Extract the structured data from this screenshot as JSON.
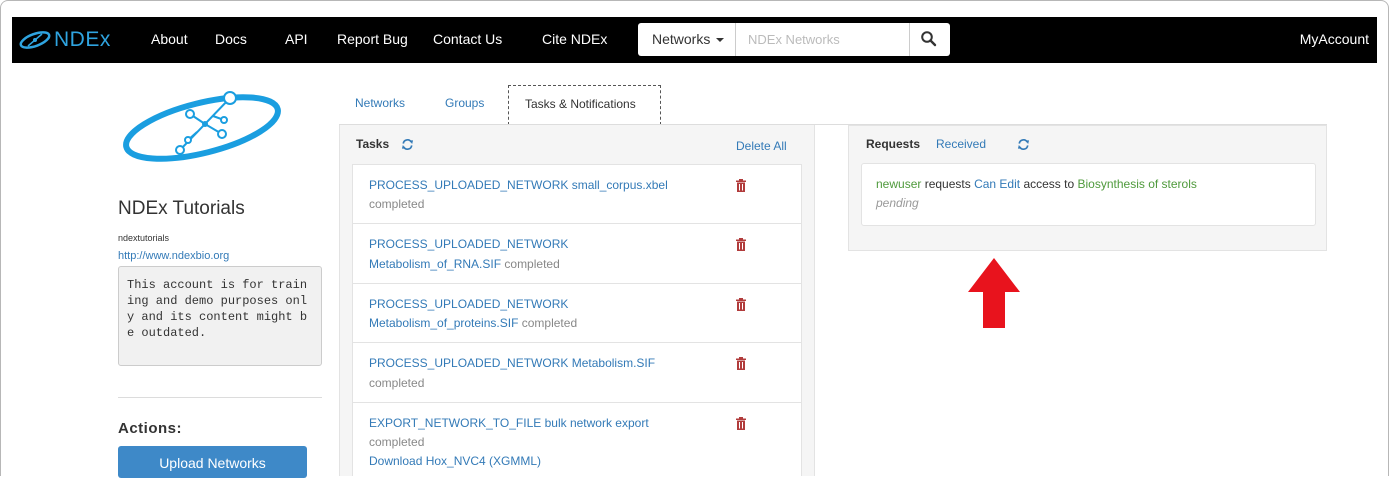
{
  "navbar": {
    "brand": "NDEx",
    "links": [
      "About",
      "Docs",
      "API",
      "Report Bug",
      "Contact Us",
      "Cite NDEx"
    ],
    "search_scope": "Networks",
    "search_placeholder": "NDEx Networks",
    "account": "MyAccount"
  },
  "profile": {
    "name": "NDEx Tutorials",
    "username": "ndextutorials",
    "url": "http://www.ndexbio.org",
    "description": "This account is for training and demo purposes only and its content might be outdated."
  },
  "actions": {
    "label": "Actions:",
    "upload_button": "Upload Networks"
  },
  "tabs": [
    "Networks",
    "Groups",
    "Tasks & Notifications"
  ],
  "tasks": {
    "title": "Tasks",
    "delete_all": "Delete All",
    "items": [
      {
        "title": "PROCESS_UPLOADED_NETWORK small_corpus.xbel",
        "file": "",
        "status": "completed",
        "extra": ""
      },
      {
        "title": "PROCESS_UPLOADED_NETWORK",
        "file": "Metabolism_of_RNA.SIF",
        "status": "completed",
        "extra": ""
      },
      {
        "title": "PROCESS_UPLOADED_NETWORK",
        "file": "Metabolism_of_proteins.SIF",
        "status": "completed",
        "extra": ""
      },
      {
        "title": "PROCESS_UPLOADED_NETWORK Metabolism.SIF",
        "file": "",
        "status": "completed",
        "extra": ""
      },
      {
        "title": "EXPORT_NETWORK_TO_FILE bulk network export",
        "file": "",
        "status": "completed",
        "extra": "Download Hox_NVC4 (XGMML)"
      }
    ]
  },
  "requests": {
    "title": "Requests",
    "received": "Received",
    "item": {
      "user": "newuser",
      "verb": "requests",
      "permission": "Can Edit",
      "mid": "access to",
      "network": "Biosynthesis of sterols",
      "status": "pending"
    }
  },
  "colors": {
    "navbar": "#000000",
    "link": "#337ab7",
    "green_link": "#4f9a3c",
    "button": "#3e89c8",
    "arrow": "#e8131d"
  }
}
